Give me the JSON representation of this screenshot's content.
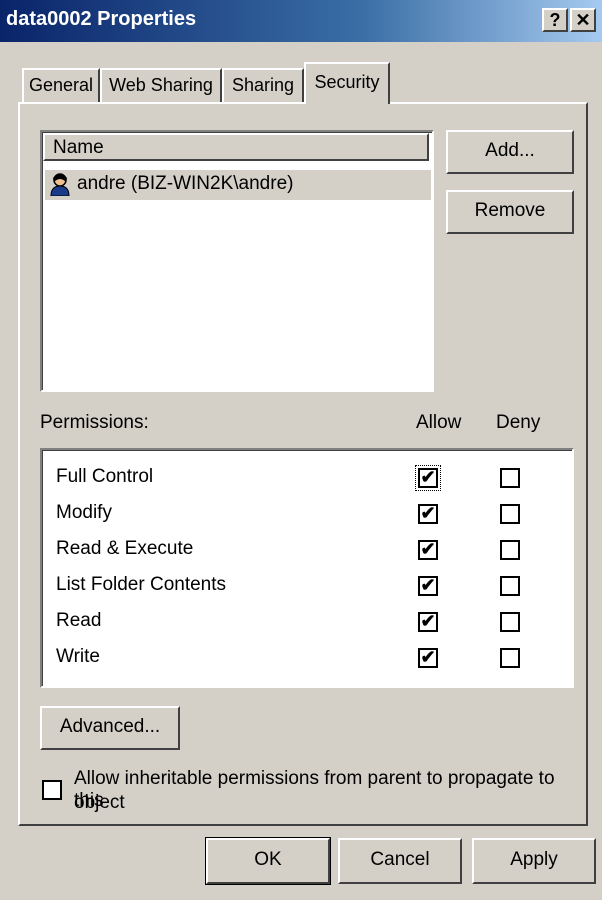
{
  "window": {
    "title": "data0002 Properties",
    "help_label": "?",
    "close_label": "✕"
  },
  "tabs": [
    {
      "label": "General",
      "active": false
    },
    {
      "label": "Web Sharing",
      "active": false
    },
    {
      "label": "Sharing",
      "active": false
    },
    {
      "label": "Security",
      "active": true
    }
  ],
  "users": {
    "column_header": "Name",
    "items": [
      {
        "name": "andre (BIZ-WIN2K\\andre)",
        "icon": "user-icon",
        "selected": true
      }
    ],
    "add_label": "Add...",
    "remove_label": "Remove"
  },
  "permissions": {
    "label": "Permissions:",
    "allow_header": "Allow",
    "deny_header": "Deny",
    "rows": [
      {
        "name": "Full Control",
        "allow": true,
        "deny": false
      },
      {
        "name": "Modify",
        "allow": true,
        "deny": false
      },
      {
        "name": "Read & Execute",
        "allow": true,
        "deny": false
      },
      {
        "name": "List Folder Contents",
        "allow": true,
        "deny": false
      },
      {
        "name": "Read",
        "allow": true,
        "deny": false
      },
      {
        "name": "Write",
        "allow": true,
        "deny": false
      }
    ]
  },
  "advanced_label": "Advanced...",
  "inherit": {
    "label_line1": "Allow inheritable permissions from parent to propagate to this",
    "label_line2": "object",
    "checked": false
  },
  "footer": {
    "ok_label": "OK",
    "cancel_label": "Cancel",
    "apply_label": "Apply"
  }
}
